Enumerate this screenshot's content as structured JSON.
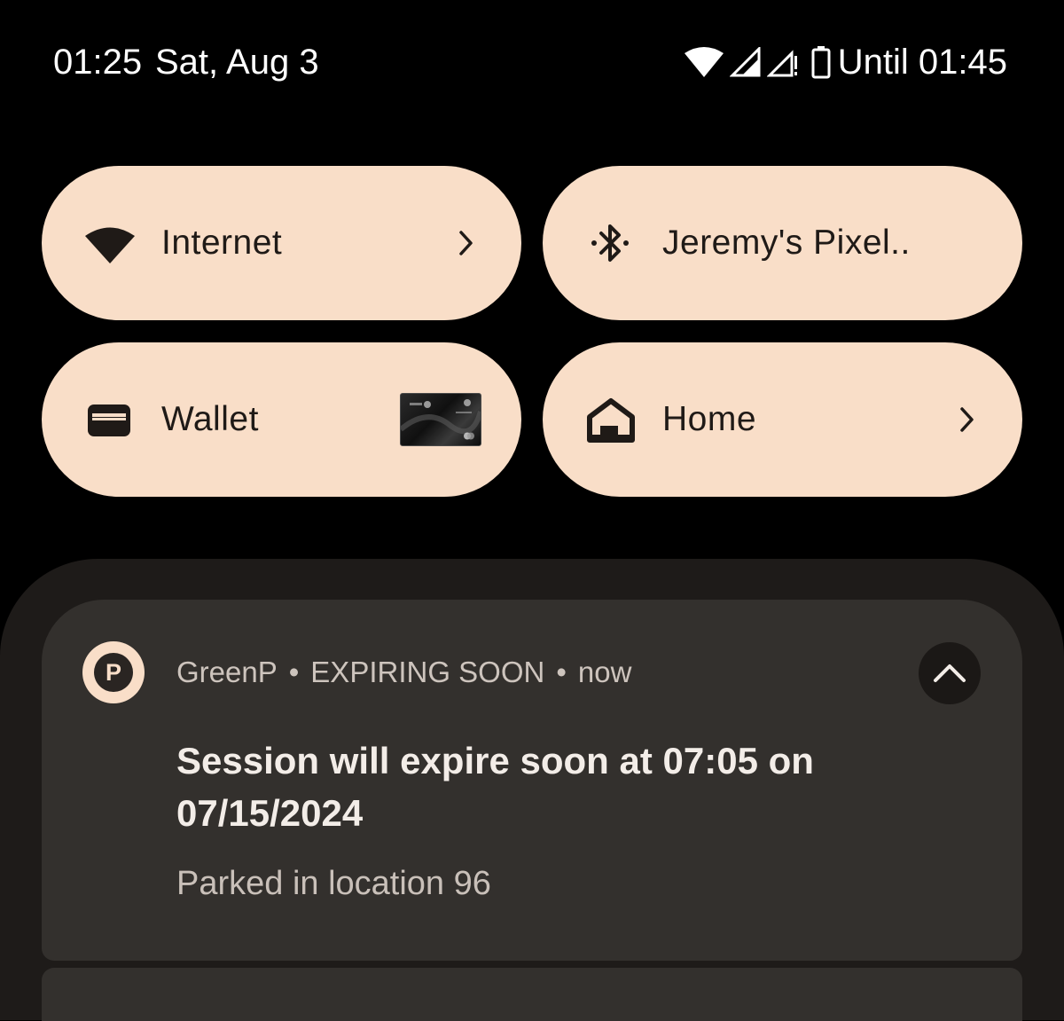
{
  "status_bar": {
    "time": "01:25",
    "date": "Sat, Aug 3",
    "icons": [
      "wifi-icon",
      "cell-signal-icon",
      "cell-signal-no-data-icon",
      "battery-icon"
    ],
    "until": "Until 01:45"
  },
  "tiles": [
    {
      "label": "Internet",
      "icon": "wifi-icon",
      "has_chevron": true
    },
    {
      "label": "Jeremy's Pixel..",
      "icon": "bluetooth-icon",
      "has_chevron": false
    },
    {
      "label": "Wallet",
      "icon": "wallet-icon",
      "thumbnail": "payment-card"
    },
    {
      "label": "Home",
      "icon": "home-icon",
      "has_chevron": true
    }
  ],
  "notification": {
    "app_icon_letter": "P",
    "app_name": "GreenP",
    "channel": "EXPIRING SOON",
    "time": "now",
    "title": "Session will expire soon at 07:05 on 07/15/2024",
    "body": "Parked in location 96"
  },
  "colors": {
    "tile_bg": "#f9dec8",
    "background": "#000000",
    "shade_bg": "#1e1b19",
    "card_bg": "#33302d"
  }
}
